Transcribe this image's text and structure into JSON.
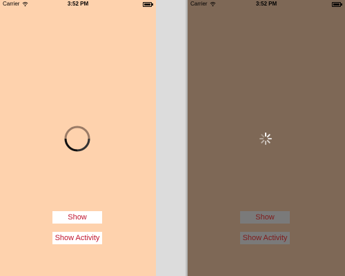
{
  "left_screen": {
    "status_bar": {
      "carrier": "Carrier",
      "time": "3:52 PM"
    },
    "background_color": "#fed2ad",
    "loader": {
      "type": "ring-progress"
    },
    "buttons": {
      "show": "Show",
      "show_activity": "Show Activity"
    }
  },
  "right_screen": {
    "status_bar": {
      "carrier": "Carrier",
      "time": "3:52 PM"
    },
    "background_color": "#7e6856",
    "loader": {
      "type": "activity-spinner"
    },
    "buttons": {
      "show": "Show",
      "show_activity": "Show Activity"
    }
  },
  "colors": {
    "button_text": "#c0152f",
    "divider": "#dcdcdc"
  }
}
